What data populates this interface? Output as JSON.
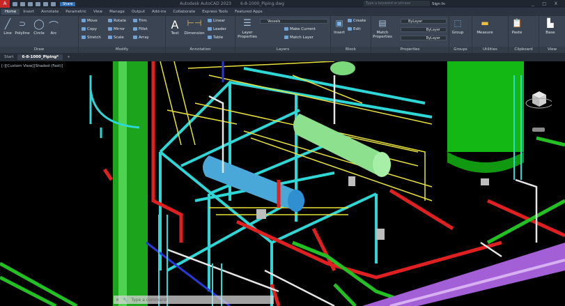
{
  "titlebar": {
    "app_title": "Autodesk AutoCAD 2023",
    "file_title": "6-8-1000_Piping.dwg",
    "share_label": "Share",
    "search_placeholder": "Type a keyword or phrase",
    "sign_in": "Sign In"
  },
  "ribbon_tabs": [
    "Home",
    "Insert",
    "Annotate",
    "Parametric",
    "View",
    "Manage",
    "Output",
    "Add-ins",
    "Collaborate",
    "Express Tools",
    "Featured Apps"
  ],
  "active_tab": "Home",
  "draw": {
    "label": "Draw",
    "line": "Line",
    "polyline": "Polyline",
    "circle": "Circle",
    "arc": "Arc"
  },
  "modify": {
    "label": "Modify",
    "move": "Move",
    "rotate": "Rotate",
    "trim": "Trim",
    "copy": "Copy",
    "mirror": "Mirror",
    "fillet": "Fillet",
    "stretch": "Stretch",
    "scale": "Scale",
    "array": "Array"
  },
  "annotation": {
    "label": "Annotation",
    "text": "Text",
    "dimension": "Dimension",
    "linear": "Linear",
    "leader": "Leader",
    "table": "Table"
  },
  "layers": {
    "label": "Layers",
    "layer_properties": "Layer Properties",
    "current_layer": "Vessels",
    "make_current": "Make Current",
    "match_layer": "Match Layer"
  },
  "block": {
    "label": "Block",
    "insert": "Insert",
    "create": "Create",
    "edit": "Edit"
  },
  "properties": {
    "label": "Properties",
    "match_properties": "Match Properties",
    "color": "ByLayer",
    "linetype": "ByLayer",
    "lineweight": "ByLayer"
  },
  "groups": {
    "label": "Groups",
    "group": "Group"
  },
  "utilities": {
    "label": "Utilities",
    "measure": "Measure"
  },
  "clipboard": {
    "label": "Clipboard",
    "paste": "Paste"
  },
  "view": {
    "label": "View",
    "base": "Base"
  },
  "file_tabs": [
    "Start",
    "6-8-1000_Piping*"
  ],
  "viewport_label": "[-][Custom View][Shaded (Fast)]",
  "command_placeholder": "Type a command",
  "colors": {
    "cyan": "#2fd6d6",
    "yellow": "#e8e23a",
    "red": "#e02020",
    "green": "#22c022",
    "purple": "#a35fd6"
  }
}
